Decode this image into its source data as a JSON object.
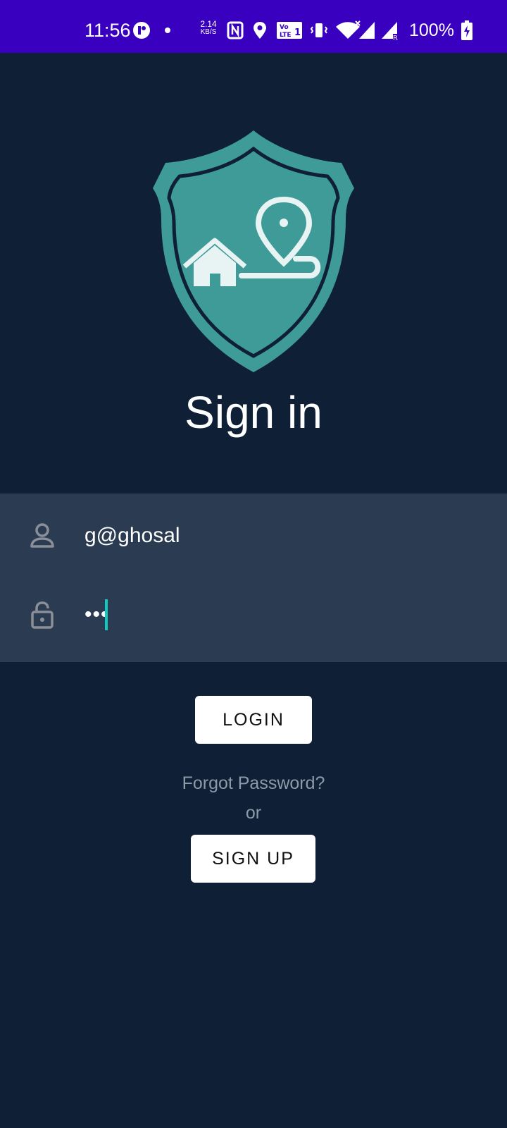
{
  "status_bar": {
    "time": "11:56",
    "net_speed_value": "2.14",
    "net_speed_unit": "KB/S",
    "battery": "100%",
    "background_color": "#3a00c0",
    "icons": [
      "app-notification-icon",
      "dot-icon",
      "nfc-icon",
      "location-icon",
      "volte-icon",
      "vibrate-icon",
      "wifi-icon",
      "signal-icon",
      "signal-roaming-icon",
      "battery-charging-icon"
    ]
  },
  "app": {
    "background_color": "#0f1f36",
    "logo": "shield-home-location-logo",
    "title": "Sign in"
  },
  "form": {
    "panel_color": "#2b3c52",
    "username_icon": "person-icon",
    "username_value": "g@ghosal",
    "password_icon": "lock-icon",
    "password_value": "•••",
    "cursor_color": "#10c9c0"
  },
  "actions": {
    "login_label": "LOGIN",
    "forgot_label": "Forgot Password?",
    "or_label": "or",
    "signup_label": "SIGN UP"
  }
}
